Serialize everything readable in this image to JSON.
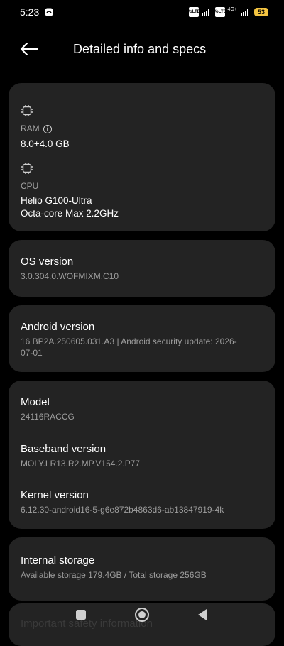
{
  "status": {
    "time": "5:23",
    "lte1": "Vo LTE",
    "lte2": "Vo LTE",
    "net_type": "4G+",
    "battery": "53"
  },
  "header": {
    "title": "Detailed info and specs"
  },
  "card_hardware": {
    "ram_label": "RAM",
    "ram_value": "8.0+4.0 GB",
    "cpu_label": "CPU",
    "cpu_value_line1": "Helio G100-Ultra",
    "cpu_value_line2": "Octa-core Max 2.2GHz"
  },
  "os": {
    "title": "OS version",
    "value": "3.0.304.0.WOFMIXM.C10"
  },
  "android": {
    "title": "Android version",
    "value": "16 BP2A.250605.031.A3 | Android security update: 2026-07-01"
  },
  "model": {
    "title": "Model",
    "value": "24116RACCG"
  },
  "baseband": {
    "title": "Baseband version",
    "value": "MOLY.LR13.R2.MP.V154.2.P77"
  },
  "kernel": {
    "title": "Kernel version",
    "value": "6.12.30-android16-5-g6e872b4863d6-ab13847919-4k"
  },
  "storage": {
    "title": "Internal storage",
    "value": "Available storage  179.4GB / Total storage  256GB"
  },
  "safety": {
    "title": "Important safety information"
  },
  "colors": {
    "background": "#000000",
    "card": "#232323",
    "battery": "#f5c542"
  }
}
